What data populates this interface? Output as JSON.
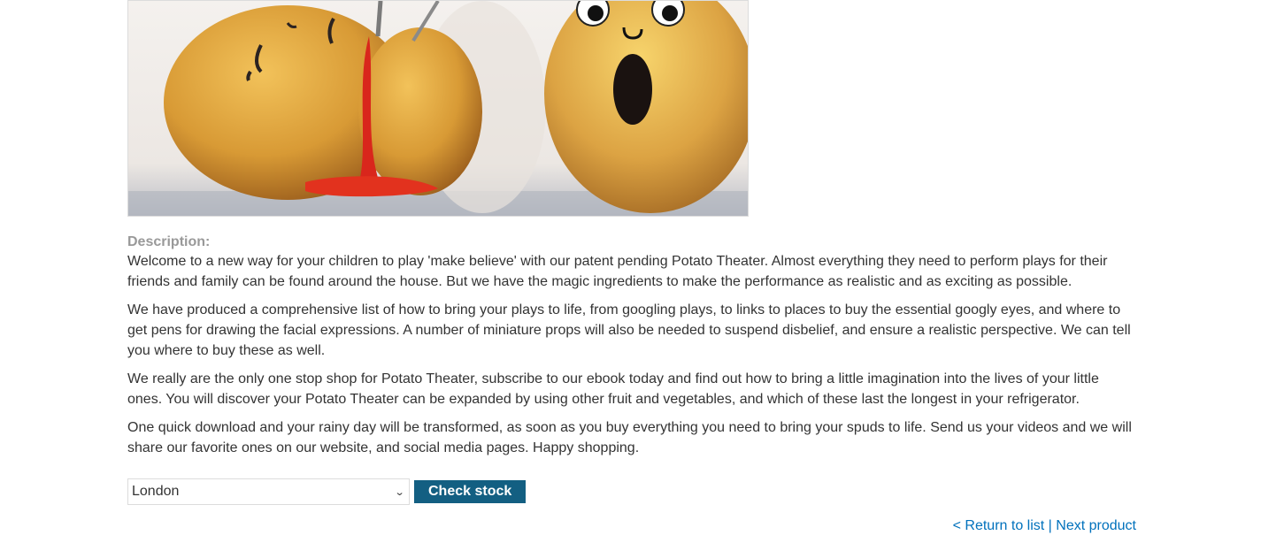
{
  "description": {
    "label": "Description:",
    "paragraphs": [
      "Welcome to a new way for your children to play 'make believe' with our patent pending Potato Theater. Almost everything they need to perform plays for their friends and family can be found around the house. But we have the magic ingredients to make the performance as realistic and as exciting as possible.",
      "We have produced a comprehensive list of how to bring your plays to life, from googling plays, to links to places to buy the essential googly eyes, and where to get pens for drawing the facial expressions. A number of miniature props will also be needed to suspend disbelief, and ensure a realistic perspective. We can tell you where to buy these as well.",
      "We really are the only one stop shop for Potato Theater, subscribe to our ebook today and find out how to bring a little imagination into the lives of your little ones. You will discover your Potato Theater can be expanded by using other fruit and vegetables, and which of these last the longest in your refrigerator.",
      "One quick download and your rainy day will be transformed, as soon as you buy everything you need to bring your spuds to life. Send us your videos and we will share our favorite ones on our website, and social media pages. Happy shopping."
    ]
  },
  "stock_form": {
    "selected_location": "London",
    "check_button": "Check stock"
  },
  "nav": {
    "return_link": "< Return to list",
    "separator": "|",
    "next_link": "Next product"
  },
  "colors": {
    "button_bg": "#135f82",
    "link": "#0071bc",
    "label": "#999999"
  }
}
